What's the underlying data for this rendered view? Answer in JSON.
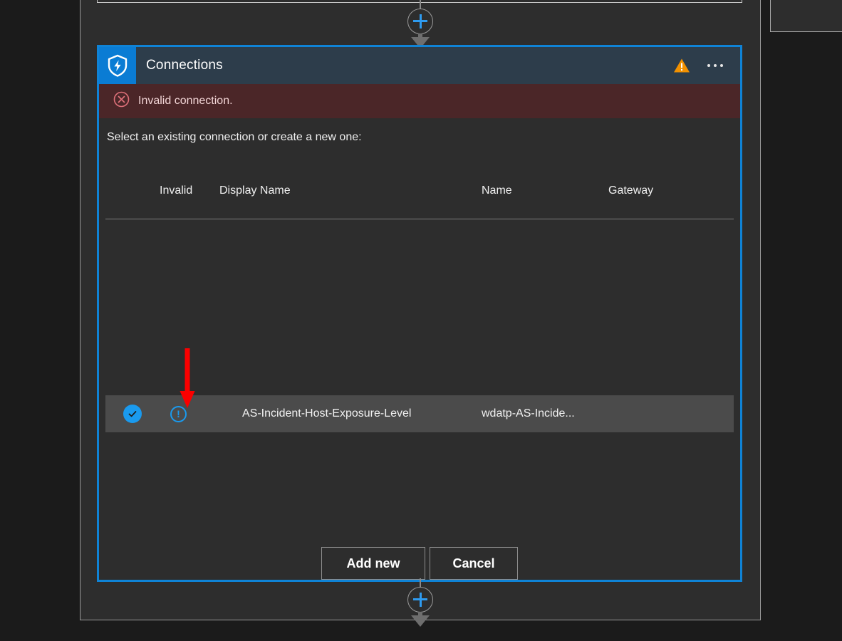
{
  "panel": {
    "title": "Connections",
    "icon": "shield-lightning-icon",
    "accent_color": "#0f83d6",
    "header_background": "#2d3d4b",
    "warning_icon": "warning-triangle-icon",
    "overflow_icon": "ellipsis-icon"
  },
  "error": {
    "icon": "error-circle-x-icon",
    "message": "Invalid connection.",
    "background": "#4b2628",
    "text_color": "#f2d5d6"
  },
  "instruction": "Select an existing connection or create a new one:",
  "table": {
    "columns": [
      "Invalid",
      "Display Name",
      "Name",
      "Gateway"
    ],
    "rows": [
      {
        "selected": true,
        "select_icon": "check-circle-icon",
        "invalid_icon": "exclamation-circle-icon",
        "display_name": "AS-Incident-Host-Exposure-Level",
        "name": "wdatp-AS-Incide...",
        "gateway": ""
      }
    ]
  },
  "buttons": {
    "add_new": "Add new",
    "cancel": "Cancel"
  },
  "connectors": {
    "top": "add-step-plus-icon",
    "bottom": "add-step-plus-icon",
    "plus_color": "#2e9bf0"
  },
  "annotation": {
    "arrow": "red-pointer-arrow",
    "color": "#ff0000"
  }
}
